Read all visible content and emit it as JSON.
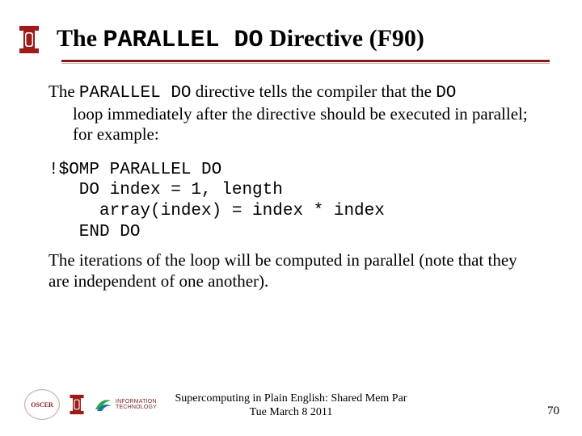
{
  "title": {
    "part1": "The ",
    "mono": "PARALLEL DO",
    "part2": " Directive (F90)"
  },
  "para1": {
    "lead": "The ",
    "mono1": "PARALLEL DO",
    "mid": " directive tells the compiler that the ",
    "mono2": "DO",
    "tail": " loop immediately after the directive should be executed in parallel; for example:"
  },
  "code": "!$OMP PARALLEL DO\n   DO index = 1, length\n     array(index) = index * index\n   END DO",
  "para2": "The iterations of the loop will be computed in parallel (note that they are independent of one another).",
  "footer": {
    "line1": "Supercomputing in Plain English: Shared Mem Par",
    "line2": "Tue March 8 2011"
  },
  "page_number": "70",
  "logos": {
    "oscer": "OSCER",
    "it_line1": "INFORMATION",
    "it_line2": "TECHNOLOGY"
  }
}
